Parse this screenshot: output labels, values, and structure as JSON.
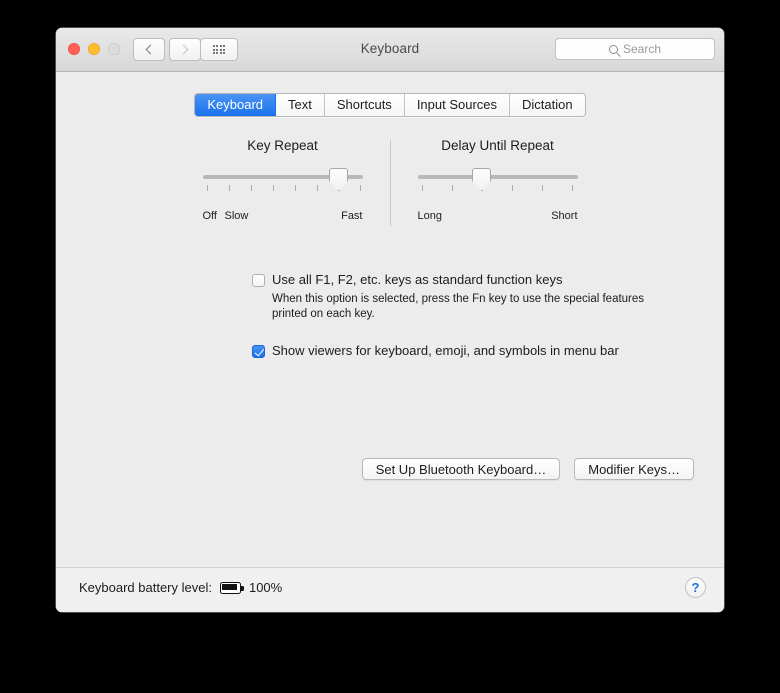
{
  "window": {
    "title": "Keyboard",
    "traffic_lights": [
      "close",
      "minimize",
      "zoom"
    ],
    "toolbar": {
      "back_icon": "chevron-left-icon",
      "forward_icon": "chevron-right-icon",
      "grid_icon": "show-all-grid-icon",
      "search": {
        "placeholder": "Search",
        "value": "",
        "icon": "search-icon"
      }
    }
  },
  "tabs": [
    {
      "label": "Keyboard",
      "active": true
    },
    {
      "label": "Text",
      "active": false
    },
    {
      "label": "Shortcuts",
      "active": false
    },
    {
      "label": "Input Sources",
      "active": false
    },
    {
      "label": "Dictation",
      "active": false
    }
  ],
  "sliders": [
    {
      "title": "Key Repeat",
      "left_label": "Off",
      "second_label": "Slow",
      "right_label": "Fast",
      "ticks": 8,
      "value_index": 6,
      "percent": 85.7
    },
    {
      "title": "Delay Until Repeat",
      "left_label": "Long",
      "right_label": "Short",
      "ticks": 6,
      "value_index": 2,
      "percent": 40
    }
  ],
  "options": [
    {
      "label": "Use all F1, F2, etc. keys as standard function keys",
      "checked": false,
      "help": "When this option is selected, press the Fn key to use the special features printed on each key."
    },
    {
      "label": "Show viewers for keyboard, emoji, and symbols in menu bar",
      "checked": true,
      "help": ""
    }
  ],
  "buttons": {
    "bluetooth": "Set Up Bluetooth Keyboard…",
    "modifier": "Modifier Keys…"
  },
  "status": {
    "battery_label": "Keyboard battery level:",
    "battery_percent": "100%",
    "battery_icon": "battery-full-icon",
    "help_icon": "help-question-icon",
    "help_glyph": "?"
  },
  "colors": {
    "accent": "#1a72ec",
    "window_bg": "#ececec",
    "titlebar_bg": "#dcdcdc",
    "desktop_bg": "#000000"
  }
}
